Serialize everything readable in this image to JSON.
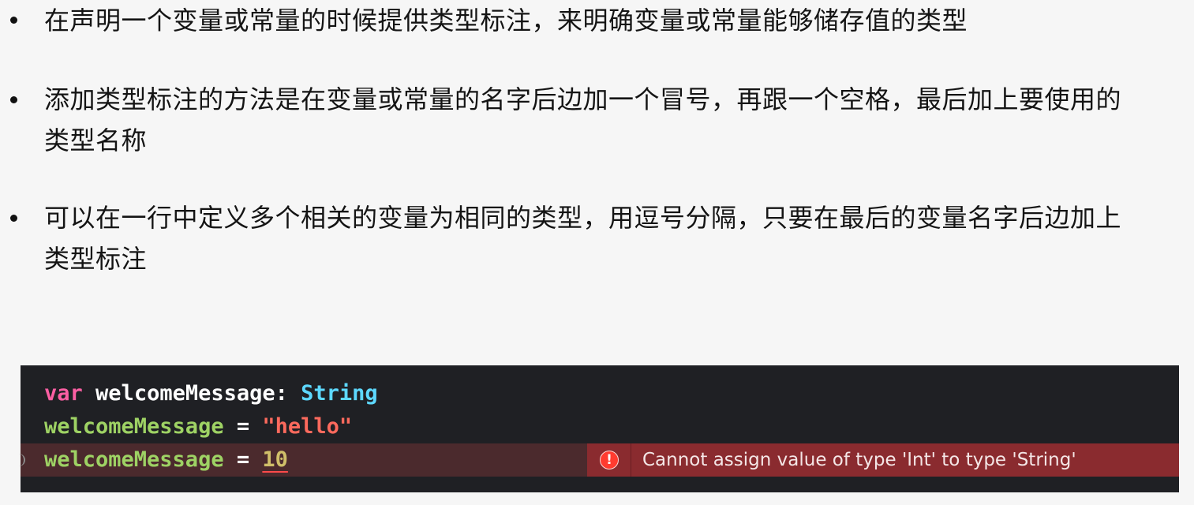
{
  "bullets": [
    {
      "text": "在声明一个变量或常量的时候提供类型标注，来明确变量或常量能够储存值的类型"
    },
    {
      "text": "添加类型标注的方法是在变量或常量的名字后边加一个冒号，再跟一个空格，最后加上要使用的类型名称"
    },
    {
      "text": "可以在一行中定义多个相关的变量为相同的类型，用逗号分隔，只要在最后的变量名字后边加上类型标注"
    }
  ],
  "code": {
    "line1": {
      "keyword": "var",
      "identifier": "welcomeMessage",
      "colon": ":",
      "type": "String"
    },
    "line2": {
      "identifier": "welcomeMessage",
      "operator": "=",
      "value": "\"hello\""
    },
    "line3": {
      "identifier": "welcomeMessage",
      "operator": "=",
      "value": "10"
    },
    "error": {
      "icon": "error-exclamation-icon",
      "message": "Cannot assign value of type 'Int' to type 'String'"
    }
  },
  "colors": {
    "keyword": "#fc5fa3",
    "type": "#5dd8ff",
    "variable_reference": "#9ed264",
    "string": "#fc6a5d",
    "number": "#d0bf69",
    "error_badge": "#8a2b2f",
    "editor_background": "#1f2024"
  }
}
